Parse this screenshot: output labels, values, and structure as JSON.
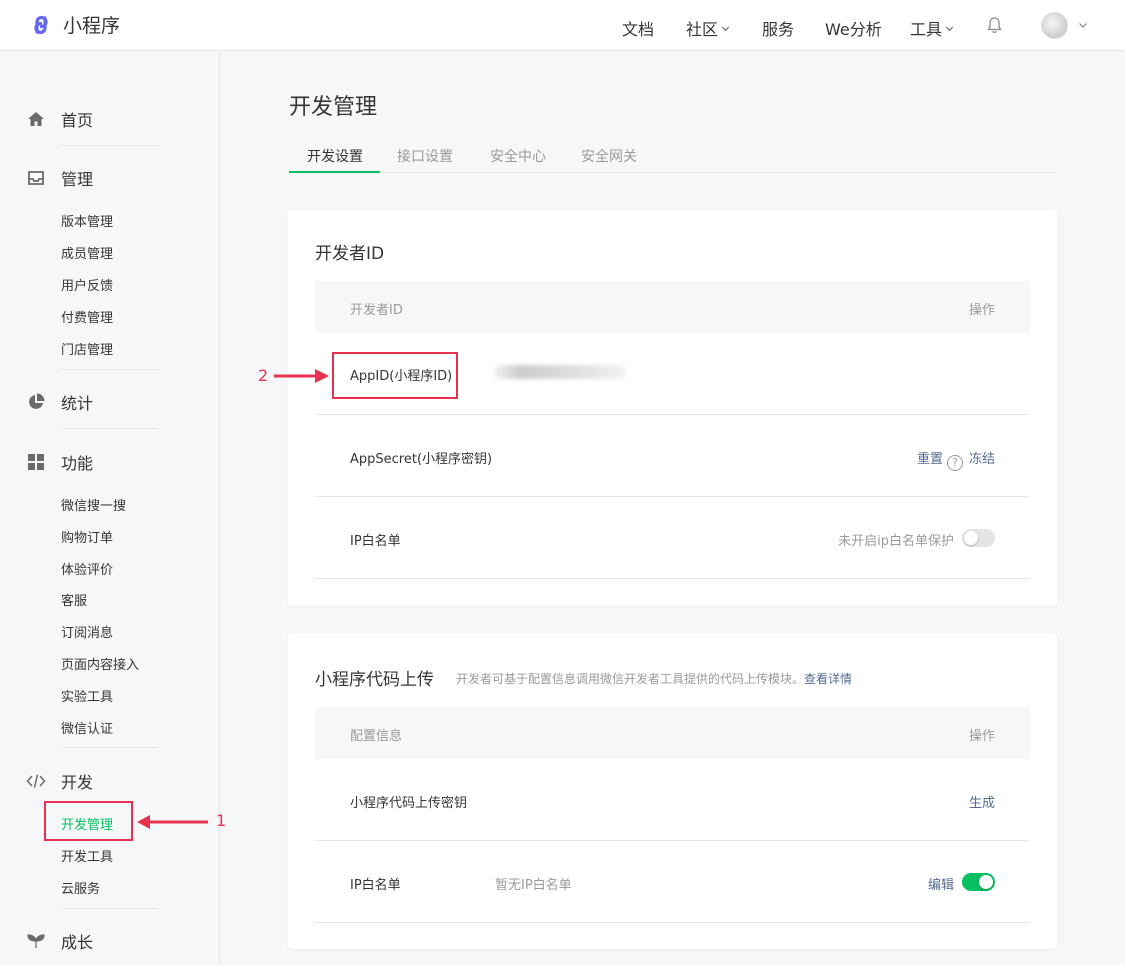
{
  "header": {
    "logo_text": "小程序",
    "nav": {
      "docs": "文档",
      "community": "社区",
      "services": "服务",
      "analytics": "We分析",
      "tools": "工具"
    }
  },
  "sidebar": {
    "sections": {
      "home": "首页",
      "manage": "管理",
      "stats": "统计",
      "features": "功能",
      "develop": "开发",
      "growth": "成长"
    },
    "manage_items": [
      "版本管理",
      "成员管理",
      "用户反馈",
      "付费管理",
      "门店管理"
    ],
    "feature_items": [
      "微信搜一搜",
      "购物订单",
      "体验评价",
      "客服",
      "订阅消息",
      "页面内容接入",
      "实验工具",
      "微信认证"
    ],
    "develop_items": [
      "开发管理",
      "开发工具",
      "云服务"
    ]
  },
  "main": {
    "title": "开发管理",
    "tabs": [
      "开发设置",
      "接口设置",
      "安全中心",
      "安全网关"
    ],
    "dev_id_card": {
      "title": "开发者ID",
      "col_left": "开发者ID",
      "col_right": "操作",
      "appid_label": "AppID(小程序ID)",
      "secret_label": "AppSecret(小程序密钥)",
      "reset": "重置",
      "help": "?",
      "freeze": "冻结",
      "ip_label": "IP白名单",
      "ip_status": "未开启ip白名单保护"
    },
    "upload_card": {
      "title": "小程序代码上传",
      "desc": "开发者可基于配置信息调用微信开发者工具提供的代码上传模块。",
      "desc_link": "查看详情",
      "col_left": "配置信息",
      "col_right": "操作",
      "key_label": "小程序代码上传密钥",
      "generate": "生成",
      "ip_label": "IP白名单",
      "ip_value": "暂无IP白名单",
      "edit": "编辑"
    }
  },
  "annotations": {
    "one": "1",
    "two": "2"
  },
  "colors": {
    "accent": "#07c160",
    "link": "#576b95",
    "annotation": "#e6314f"
  }
}
